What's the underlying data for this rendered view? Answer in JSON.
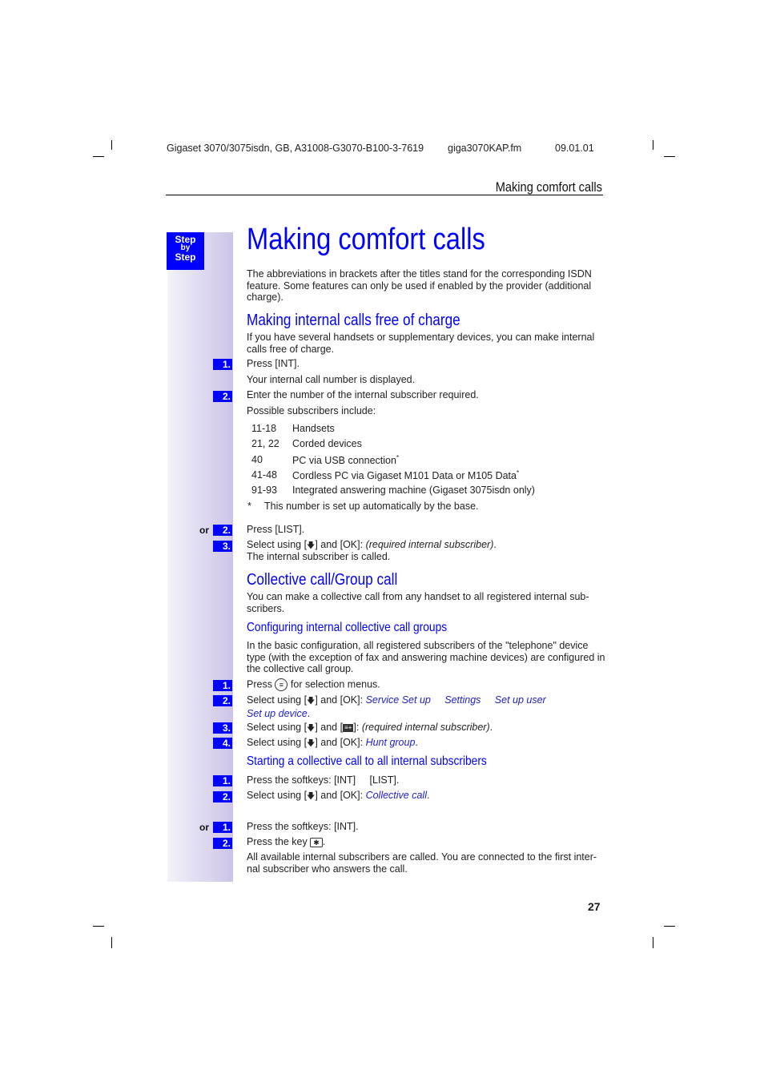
{
  "header": {
    "doc_id": "Gigaset 3070/3075isdn, GB, A31008-G3070-B100-3-7619",
    "file": "giga3070KAP.fm",
    "date": "09.01.01",
    "running_title": "Making comfort calls"
  },
  "step_badge": {
    "line1": "Step",
    "line2": "by",
    "line3": "Step"
  },
  "title": "Making comfort calls",
  "intro": "The abbreviations in brackets after the titles stand for the corresponding ISDN feature. Some features can only be used if enabled by the provider (additional charge).",
  "section1": {
    "heading": "Making internal calls free of charge",
    "text": "If you have several handsets or supplementary devices, you can make internal calls free of charge.",
    "step1_num": "1.",
    "step1": "Press [INT].",
    "step1_note": "Your internal call number is displayed.",
    "step2_num": "2.",
    "step2": "Enter the number of the internal subscriber required.",
    "possible": "Possible subscribers include:",
    "subscribers": [
      {
        "num": "11-18",
        "desc": "Handsets",
        "star": ""
      },
      {
        "num": "21, 22",
        "desc": "Corded devices",
        "star": ""
      },
      {
        "num": "40",
        "desc": "PC via USB connection",
        "star": "*"
      },
      {
        "num": "41-48",
        "desc": "Cordless PC via Gigaset M101 Data or M105 Data",
        "star": "*"
      },
      {
        "num": "91-93",
        "desc": "Integrated answering machine (Gigaset 3075isdn only)",
        "star": ""
      }
    ],
    "footnote_mark": "*",
    "footnote": "This number is set up automatically by the base.",
    "or": "or",
    "alt2_num": "2.",
    "alt2": "Press [LIST].",
    "alt3_num": "3.",
    "alt3_pre": "Select using [",
    "alt3_mid": "] and [OK]: ",
    "alt3_italic": "(required internal subscriber)",
    "alt3_end": ".",
    "alt3_note": "The internal subscriber is called."
  },
  "section2": {
    "heading": "Collective call/Group call",
    "text": "You can make a collective call from any handset to all registered internal sub-scribers.",
    "sub1": {
      "heading": "Configuring internal collective call groups",
      "text": "In the basic configuration, all registered subscribers of the \"telephone\" device type (with the exception of fax and answering machine devices) are configured in the collective call group.",
      "s1_num": "1.",
      "s1_pre": "Press",
      "s1_post": "for selection menus.",
      "s2_num": "2.",
      "s2_pre": "Select using [",
      "s2_mid": "] and [OK]: ",
      "s2_menu": [
        "Service Set up",
        "Settings",
        "Set up user",
        "Set up device"
      ],
      "s3_num": "3.",
      "s3_pre": "Select using [",
      "s3_mid": "] and [",
      "s3_post": "]: ",
      "s3_italic": "(required internal subscriber)",
      "s4_num": "4.",
      "s4_pre": "Select using [",
      "s4_mid": "] and [OK]: ",
      "s4_italic": "Hunt group"
    },
    "sub2": {
      "heading": "Starting a collective call to all internal subscribers",
      "s1_num": "1.",
      "s1_a": "Press the softkeys: [INT]",
      "s1_b": "[LIST].",
      "s2_num": "2.",
      "s2_pre": "Select using [",
      "s2_mid": "] and [OK]: ",
      "s2_italic": "Collective call",
      "or": "or",
      "a1_num": "1.",
      "a1": "Press the softkeys: [INT].",
      "a2_num": "2.",
      "a2_pre": "Press the key",
      "a2_key": "✱",
      "result": "All available internal subscribers are called. You are connected to the first inter-nal subscriber who answers the call."
    }
  },
  "icons": {
    "down_arrow": "🡇",
    "menu": "≡",
    "display_key": "≡+"
  },
  "page_number": "27",
  "colors": {
    "accent": "#0000ff",
    "sidebar_from": "#f4f2fa",
    "sidebar_to": "#ccc4e8"
  }
}
